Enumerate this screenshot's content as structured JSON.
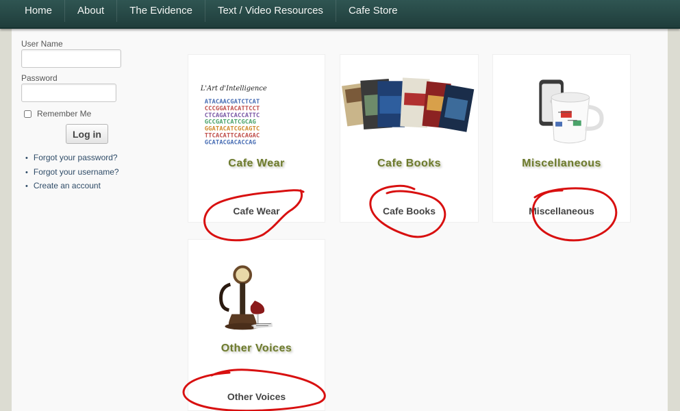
{
  "nav": {
    "items": [
      "Home",
      "About",
      "The Evidence",
      "Text / Video Resources",
      "Cafe Store"
    ]
  },
  "login": {
    "username_label": "User Name",
    "username_value": "",
    "password_label": "Password",
    "password_value": "",
    "remember_label": "Remember Me",
    "remember_checked": false,
    "button_label": "Log in",
    "links": [
      "Forgot your password?",
      "Forgot your username?",
      "Create an account"
    ]
  },
  "store": {
    "categories": [
      {
        "caption": "Cafe Wear",
        "link": "Cafe Wear",
        "image_title": "L'Art d'Intelligence",
        "dna_lines": [
          "ATACAACGATCTCAT",
          "CCCGGATACATTCCT",
          "CTCAGATCACCATTC",
          "GCCGATCATCGCAG",
          "GGATACATCGCAGTC",
          "TTCACATTCACAGAC",
          "GCATACGACACCAG"
        ]
      },
      {
        "caption": "Cafe Books",
        "link": "Cafe Books"
      },
      {
        "caption": "Miscellaneous",
        "link": "Miscellaneous"
      },
      {
        "caption": "Other Voices",
        "link": "Other Voices"
      }
    ]
  },
  "colors": {
    "nav_bg": "#2a4b48",
    "annotation": "#d81010",
    "caption_olive": "#6d7a2f",
    "link": "#2e4b67"
  }
}
